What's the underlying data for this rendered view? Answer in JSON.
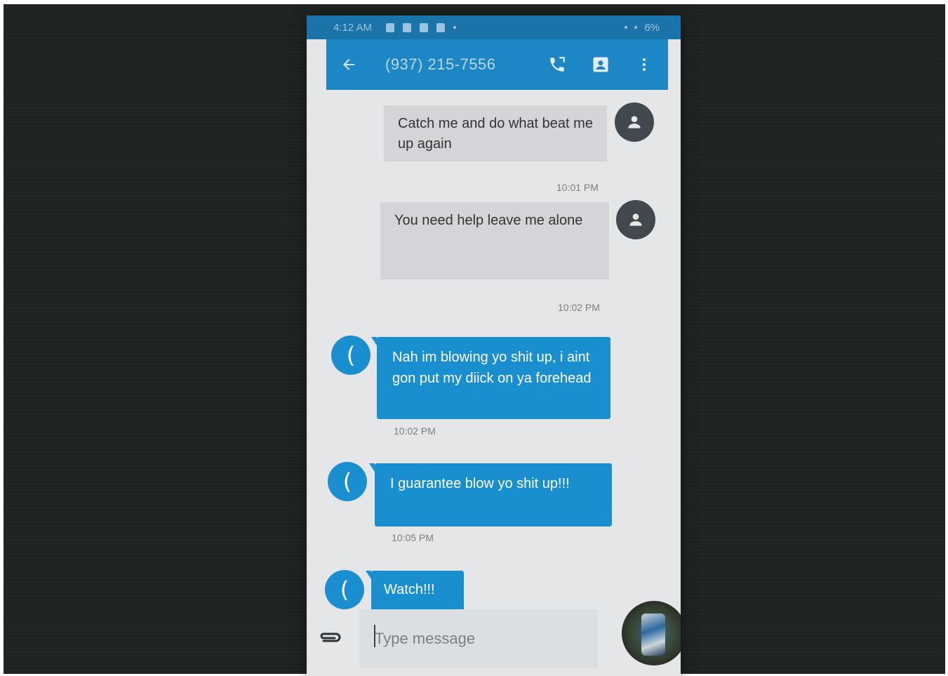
{
  "status_bar": {
    "time": "4:12 AM",
    "battery": "6%"
  },
  "header": {
    "title": "(937) 215-7556"
  },
  "messages": [
    {
      "direction": "incoming",
      "text": "Catch me and do what beat me up again",
      "time": "10:01 PM"
    },
    {
      "direction": "incoming",
      "text": "You need help leave me alone",
      "time": "10:02 PM"
    },
    {
      "direction": "outgoing",
      "text": "Nah im blowing yo shit up, i aint gon put my diick on ya forehead",
      "time": "10:02 PM",
      "avatar": "("
    },
    {
      "direction": "outgoing",
      "text": "I guarantee blow yo shit up!!!",
      "time": "10:05 PM",
      "avatar": "("
    },
    {
      "direction": "outgoing",
      "text": "Watch!!!",
      "avatar": "("
    }
  ],
  "composer": {
    "placeholder": "Type message"
  },
  "icons": {
    "back": "arrow-left-icon",
    "call": "phone-call-icon",
    "contact": "contact-card-icon",
    "menu": "more-vert-icon",
    "attach": "paperclip-icon",
    "avatar_incoming": "person-icon"
  },
  "colors": {
    "app_bar": "#1d86c4",
    "outgoing_bubble": "#1a8fcf",
    "incoming_bubble": "#d3d5d8"
  }
}
